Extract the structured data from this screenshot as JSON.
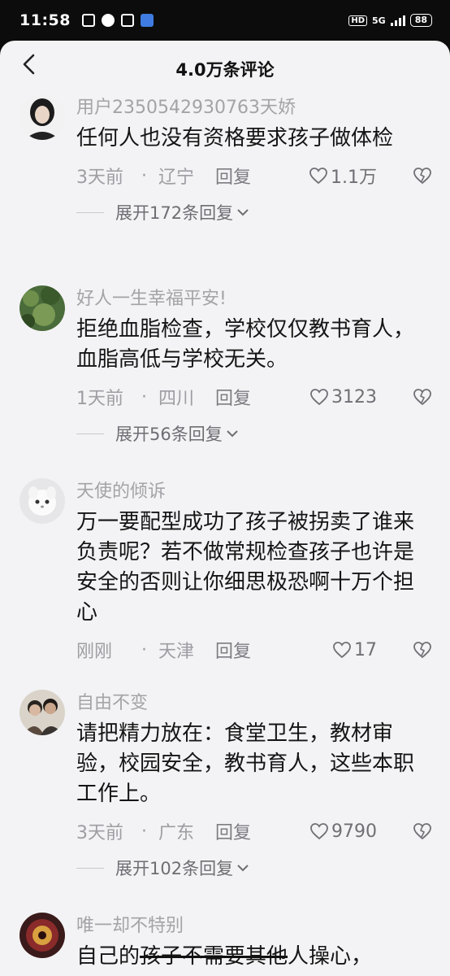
{
  "status_bar": {
    "time": "11:58",
    "hd": "HD",
    "network": "5G",
    "battery": "88"
  },
  "header": {
    "title": "4.0万条评论",
    "back_icon": "chevron-left-icon"
  },
  "colors": {
    "sheet_bg": "#f3f3f5",
    "text": "#151515",
    "muted": "#a3a3a8"
  },
  "comments": [
    {
      "username": "用户2350542930763天娇",
      "content": "任何人也没有资格要求孩子做体检",
      "time": "3天前",
      "location": "辽宁",
      "reply": "回复",
      "likes": "1.1万",
      "expand": "展开172条回复"
    },
    {
      "username": "好人一生幸福平安!",
      "content": "拒绝血脂检查，学校仅仅教书育人，血脂高低与学校无关。",
      "time": "1天前",
      "location": "四川",
      "reply": "回复",
      "likes": "3123",
      "expand": "展开56条回复"
    },
    {
      "username": "天使的倾诉",
      "content": "万一要配型成功了孩子被拐卖了谁来负责呢？若不做常规检查孩子也许是安全的否则让你细思极恐啊十万个担心",
      "time": "刚刚",
      "location": "天津",
      "reply": "回复",
      "likes": "17"
    },
    {
      "username": "自由不变",
      "content": "请把精力放在：食堂卫生，教材审验，校园安全，教书育人，这些本职工作上。",
      "time": "3天前",
      "location": "广东",
      "reply": "回复",
      "likes": "9790",
      "expand": "展开102条回复"
    },
    {
      "username": "唯一却不特别",
      "content_a": "自己的",
      "content_b": "孩子不需要其他",
      "content_c": "人操心，"
    }
  ]
}
